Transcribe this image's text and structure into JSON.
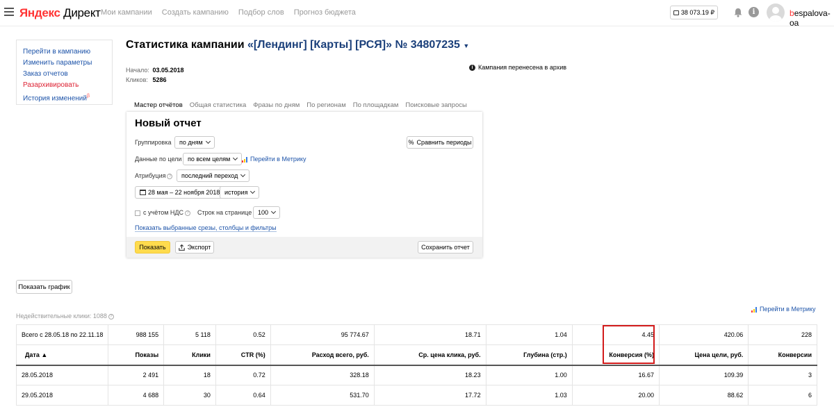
{
  "header": {
    "logo_yandex": "Яндекс",
    "logo_direct": "Директ",
    "nav": [
      "Мои кампании",
      "Создать кампанию",
      "Подбор слов",
      "Прогноз бюджета"
    ],
    "balance": "38 073.19 ₽",
    "user_first": "b",
    "user_rest": "espalova-oa",
    "icons": [
      "menu-icon",
      "wallet-icon",
      "bell-icon",
      "info-icon",
      "avatar"
    ]
  },
  "sidemenu": {
    "items": [
      "Перейти в кампанию",
      "Изменить параметры",
      "Заказ отчетов",
      "Разархивировать",
      "История изменений"
    ],
    "sup": "β"
  },
  "campaign": {
    "title_prefix": "Статистика кампании",
    "name": "«[Лендинг] [Карты] [РСЯ]» № 34807235",
    "start_label": "Начало:",
    "start_value": "03.05.2018",
    "clicks_label": "Кликов:",
    "clicks_value": "5286",
    "archive_note": "Кампания перенесена в архив"
  },
  "tabs": [
    "Мастер отчётов",
    "Общая статистика",
    "Фразы по дням",
    "По регионам",
    "По площадкам",
    "Поисковые запросы"
  ],
  "report": {
    "title": "Новый отчет",
    "grouping_label": "Группировка",
    "grouping_value": "по дням",
    "compare_label": "Сравнить периоды",
    "goal_label": "Данные по цели",
    "goal_value": "по всем целям",
    "metrika_link": "Перейти в Метрику",
    "attribution_label": "Атрибуция",
    "attribution_value": "последний переход",
    "date_range": "28 мая – 22 ноября 2018",
    "history_value": "история",
    "vat_label": "с учётом НДС",
    "rows_label": "Строк на странице",
    "rows_value": "100",
    "slices_link": "Показать выбранные срезы, столбцы и фильтры",
    "show_button": "Показать",
    "export_button": "Экспорт",
    "save_button": "Сохранить отчет"
  },
  "show_graph": "Показать график",
  "invalid_clicks": "Недействительные клики: 1088",
  "metrika_link2": "Перейти в Метрику",
  "table": {
    "totals": [
      "Всего с 28.05.18 по 22.11.18",
      "988 155",
      "5 118",
      "0.52",
      "95 774.67",
      "18.71",
      "1.04",
      "4.45",
      "420.06",
      "228"
    ],
    "headers": [
      "Дата ▲",
      "Показы",
      "Клики",
      "CTR (%)",
      "Расход всего, руб.",
      "Ср. цена клика, руб.",
      "Глубина (стр.)",
      "Конверсия (%)",
      "Цена цели, руб.",
      "Конверсии"
    ],
    "rows": [
      [
        "28.05.2018",
        "2 491",
        "18",
        "0.72",
        "328.18",
        "18.23",
        "1.00",
        "16.67",
        "109.39",
        "3"
      ],
      [
        "29.05.2018",
        "4 688",
        "30",
        "0.64",
        "531.70",
        "17.72",
        "1.03",
        "20.00",
        "88.62",
        "6"
      ]
    ]
  },
  "colors": {
    "accent_red": "#d21a1a",
    "link_blue": "#1b52a8",
    "button_yellow": "#ffdb4d"
  }
}
